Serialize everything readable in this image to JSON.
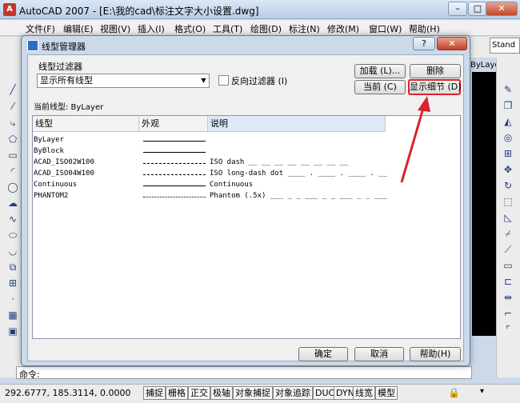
{
  "window": {
    "title": "AutoCAD 2007 - [E:\\我的cad\\标注文字大小设置.dwg]",
    "app_icon": "A",
    "min": "–",
    "max": "□",
    "close": "✕"
  },
  "menu": [
    "文件(F)",
    "编辑(E)",
    "视图(V)",
    "插入(I)",
    "格式(O)",
    "工具(T)",
    "绘图(D)",
    "标注(N)",
    "修改(M)",
    "窗口(W)",
    "帮助(H)"
  ],
  "toolbar": {
    "style_combo": "Stand",
    "bylayer": "ByLayer"
  },
  "dialog": {
    "title": "线型管理器",
    "help": "?",
    "close": "✕",
    "filter_label": "线型过滤器",
    "filter_value": "显示所有线型",
    "invert_label": "反向过滤器 (I)",
    "btn_load": "加载 (L)...",
    "btn_delete": "删除",
    "btn_current": "当前 (C)",
    "btn_details": "显示细节 (D)",
    "current_label": "当前线型:  ByLayer",
    "columns": [
      "线型",
      "外观",
      "说明"
    ],
    "rows": [
      {
        "name": "ByLayer",
        "desc": ""
      },
      {
        "name": "ByBlock",
        "desc": ""
      },
      {
        "name": "ACAD_ISO02W100",
        "desc": "ISO dash __ __ __ __ __ __ __ __"
      },
      {
        "name": "ACAD_ISO04W100",
        "desc": "ISO long-dash dot ____ . ____ . ____ . __"
      },
      {
        "name": "Continuous",
        "desc": "Continuous"
      },
      {
        "name": "PHANTOM2",
        "desc": "Phantom (.5x) ___ _ _ ___ _ _ ___ _ _ ___"
      }
    ],
    "btn_ok": "确定",
    "btn_cancel": "取消",
    "btn_help": "帮助(H)"
  },
  "command": {
    "label": "命令:"
  },
  "status": {
    "coords": "292.6777, 185.3114, 0.0000",
    "buttons": [
      "捕捉",
      "栅格",
      "正交",
      "极轴",
      "对象捕捉",
      "对象追踪",
      "DUCS",
      "DYN",
      "线宽",
      "模型"
    ]
  },
  "colors": {
    "highlight": "#d9232d",
    "accent": "#2e6fbf"
  }
}
